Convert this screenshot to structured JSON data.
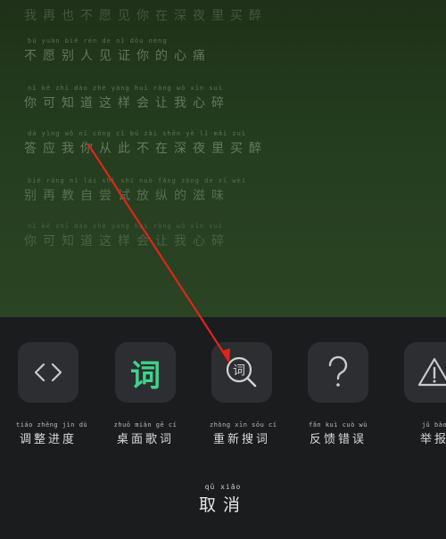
{
  "lyrics": [
    {
      "pinyin": "",
      "text": "我再也不愿见你在深夜里买醉"
    },
    {
      "pinyin": "bú yuàn bié rén de nǐ dōu néng",
      "text": "不愿别人见证你的心痛"
    },
    {
      "pinyin": "nǐ kě zhī dào zhè yàng huì ràng wǒ xīn suì",
      "text": "你可知道这样会让我心碎"
    },
    {
      "pinyin": "dā yìng wǒ nǐ cóng cǐ bú zài shēn yè lǐ mǎi zuì",
      "text": "答应我你从此不在深夜里买醉"
    },
    {
      "pinyin": "bié ràng nǐ lái shì shí nuò fǎng zòng de zī wèi",
      "text": "别再教自尝试放纵的滋味"
    },
    {
      "pinyin": "nǐ kě zhī dào zhè yàng huì ràng wǒ xīn suì",
      "text": "你可知道这样会让我心碎"
    }
  ],
  "actions": [
    {
      "icon": "code-brackets-icon",
      "glyph": "‹ ›",
      "pinyin": "tiáo zhěng jìn dù",
      "label": "调整进度"
    },
    {
      "icon": "lyric-word-icon",
      "glyph": "词",
      "pinyin": "zhuō miàn gē cí",
      "label": "桌面歌词"
    },
    {
      "icon": "search-lyric-icon",
      "glyph": "词",
      "pinyin": "zhòng xīn sōu cí",
      "label": "重新搜词"
    },
    {
      "icon": "question-mark-icon",
      "glyph": "?",
      "pinyin": "fǎn kuì cuò wù",
      "label": "反馈错误"
    },
    {
      "icon": "warning-icon",
      "glyph": "!",
      "pinyin": "jǔ bào",
      "label": "举报"
    }
  ],
  "cancel": {
    "pinyin": "qǔ xiāo",
    "label": "取消"
  },
  "colors": {
    "accent": "#3ed38c",
    "tile": "#2c2e31",
    "sheet": "#1b1c1e",
    "arrow": "#e0241b"
  }
}
